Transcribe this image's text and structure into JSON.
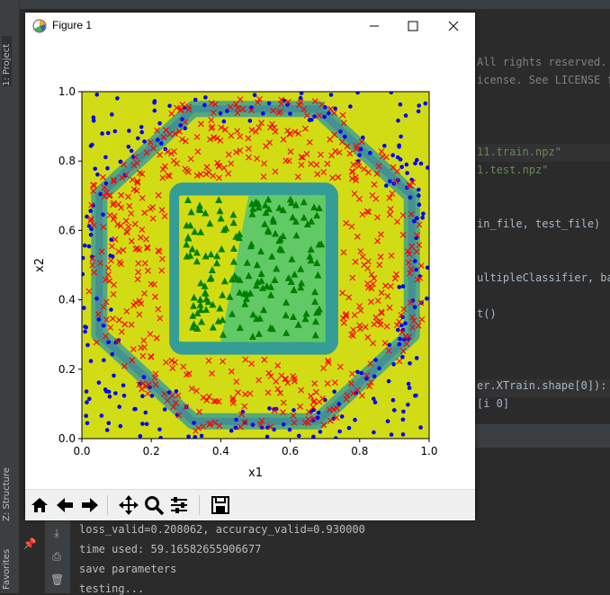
{
  "ide": {
    "vertical_tabs": {
      "project": "1: Project",
      "structure": "Z: Structure",
      "favorites": "Favorites"
    },
    "editor_lines": [
      {
        "text": "All rights reserved.",
        "cls": "c-gray"
      },
      {
        "text": "icense. See LICENSE fi",
        "cls": "c-gray"
      },
      {
        "text": "11.train.npz\"",
        "cls": "c-green"
      },
      {
        "text": "1.test.npz\"",
        "cls": "c-green"
      },
      {
        "text": "in_file, test_file)",
        "cls": "c-def"
      },
      {
        "text": "ultipleClassifier, ba",
        "cls": "c-def"
      },
      {
        "text": "t()",
        "cls": "c-def"
      },
      {
        "text": "er.XTrain.shape[0]):",
        "cls": "c-def"
      },
      {
        "text": "[i 0] ",
        "cls": "c-def"
      }
    ],
    "console_lines": [
      "loss_valid=0.208062, accuracy_valid=0.930000",
      "time used: 59.16582655906677",
      "save parameters",
      "testing..."
    ]
  },
  "figure": {
    "title": "Figure 1",
    "accent": "#1f77b4"
  },
  "chart_data": {
    "type": "scatter",
    "title": "",
    "xlabel": "x1",
    "ylabel": "x2",
    "xlim": [
      0.0,
      1.0
    ],
    "ylim": [
      0.0,
      1.0
    ],
    "xticks": [
      "0.0",
      "0.2",
      "0.4",
      "0.6",
      "0.8",
      "1.0"
    ],
    "yticks": [
      "0.0",
      "0.2",
      "0.4",
      "0.6",
      "0.8",
      "1.0"
    ],
    "background": {
      "type": "decision-regions",
      "colors": {
        "outer": "#d2dc14",
        "border": "#2b9a9e",
        "ring": "#d2dc14",
        "square": "#5cc86a",
        "inner": "#d2dc14"
      },
      "octagon_vertices": [
        [
          0.05,
          0.3
        ],
        [
          0.05,
          0.7
        ],
        [
          0.32,
          0.95
        ],
        [
          0.68,
          0.95
        ],
        [
          0.95,
          0.7
        ],
        [
          0.95,
          0.3
        ],
        [
          0.68,
          0.05
        ],
        [
          0.32,
          0.05
        ]
      ],
      "square": [
        [
          0.27,
          0.26
        ],
        [
          0.72,
          0.72
        ]
      ],
      "inner_region": [
        [
          0.28,
          0.7
        ],
        [
          0.48,
          0.7
        ],
        [
          0.4,
          0.28
        ],
        [
          0.28,
          0.28
        ]
      ]
    },
    "series": [
      {
        "name": "class-blue",
        "marker": "dot",
        "color": "#0000ff",
        "region": "outside-octagon",
        "count": 260
      },
      {
        "name": "class-red",
        "marker": "x",
        "color": "#ff0000",
        "region": "ring",
        "count": 520
      },
      {
        "name": "class-green",
        "marker": "triangle",
        "color": "#008000",
        "region": "square",
        "count": 170
      }
    ]
  },
  "toolbar": {
    "buttons": [
      "home-icon",
      "back-icon",
      "forward-icon",
      "pan-icon",
      "zoom-icon",
      "configure-icon",
      "save-icon"
    ]
  }
}
